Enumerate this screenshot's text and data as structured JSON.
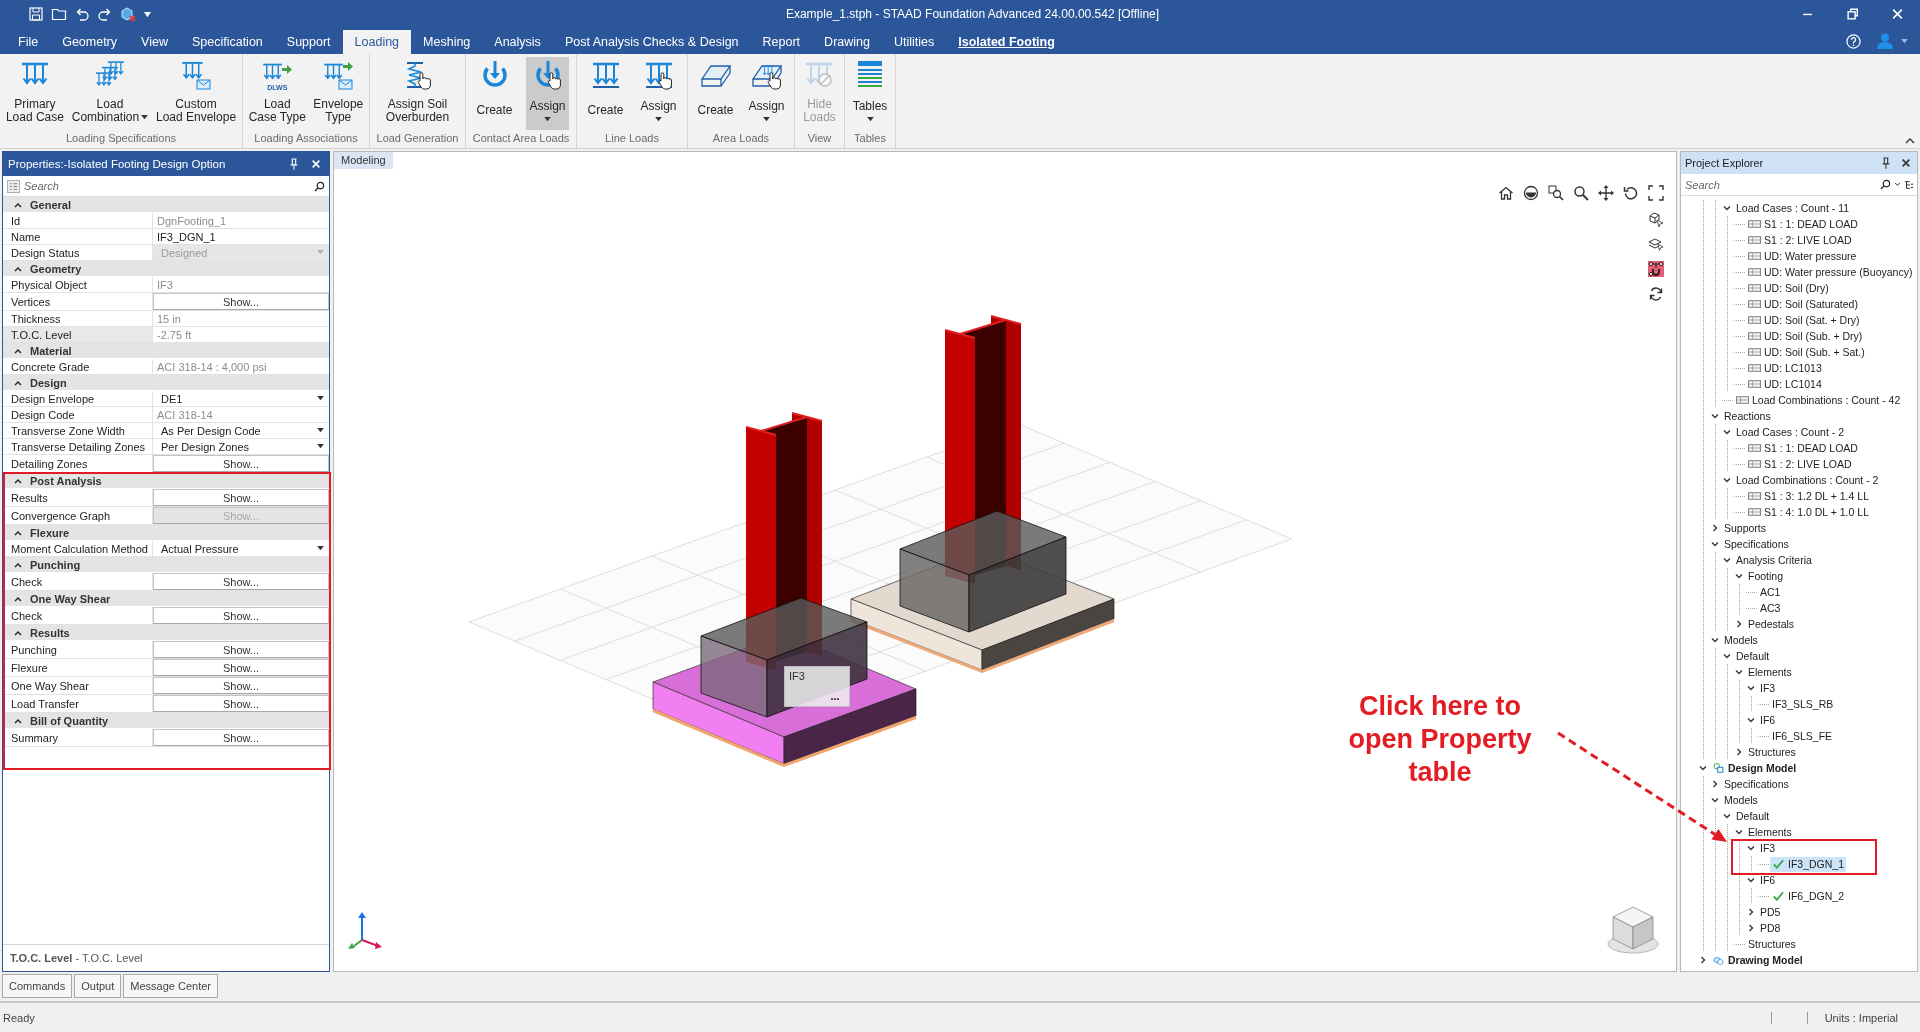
{
  "window": {
    "title": "Example_1.stph - STAAD Foundation Advanced 24.00.00.542 [Offline]"
  },
  "menu_tabs": [
    {
      "label": "File",
      "kind": "tab",
      "selected": false
    },
    {
      "label": "Geometry",
      "kind": "tab",
      "selected": false
    },
    {
      "label": "View",
      "kind": "tab",
      "selected": false
    },
    {
      "label": "Specification",
      "kind": "tab",
      "selected": false
    },
    {
      "label": "Support",
      "kind": "tab",
      "selected": false
    },
    {
      "label": "Loading",
      "kind": "tab",
      "selected": true
    },
    {
      "label": "Meshing",
      "kind": "tab",
      "selected": false
    },
    {
      "label": "Analysis",
      "kind": "tab",
      "selected": false
    },
    {
      "label": "Post Analysis Checks & Design",
      "kind": "tab",
      "selected": false
    },
    {
      "label": "Report",
      "kind": "tab",
      "selected": false
    },
    {
      "label": "Drawing",
      "kind": "tab",
      "selected": false
    },
    {
      "label": "Utilities",
      "kind": "tab",
      "selected": false
    },
    {
      "label": "Isolated Footing",
      "kind": "context",
      "selected": false
    }
  ],
  "ribbon": {
    "groups": [
      {
        "label": "Loading Specifications",
        "buttons": [
          {
            "kind": "primary-load",
            "lines": [
              "Primary",
              "Load Case"
            ],
            "dropdown": false,
            "pressed": false,
            "disabled": false
          },
          {
            "kind": "load-combination",
            "lines": [
              "Load",
              "Combination"
            ],
            "dropdown": true,
            "pressed": false,
            "disabled": false
          },
          {
            "kind": "custom-envelope",
            "lines": [
              "Custom",
              "Load Envelope"
            ],
            "dropdown": false,
            "pressed": false,
            "disabled": false
          }
        ]
      },
      {
        "label": "Loading Associations",
        "buttons": [
          {
            "kind": "load-case-type",
            "badge": "DLWS",
            "lines": [
              "Load",
              "Case Type"
            ],
            "dropdown": false,
            "pressed": false,
            "disabled": false
          },
          {
            "kind": "envelope-type",
            "lines": [
              "Envelope",
              "Type"
            ],
            "dropdown": false,
            "pressed": false,
            "disabled": false
          }
        ]
      },
      {
        "label": "Load Generation",
        "buttons": [
          {
            "kind": "soil-overburden",
            "lines": [
              "Assign Soil",
              "Overburden"
            ],
            "dropdown": false,
            "pressed": false,
            "disabled": false
          }
        ]
      },
      {
        "label": "Contact Area Loads",
        "buttons": [
          {
            "kind": "contact-create",
            "lines": [
              "Create"
            ],
            "dropdown": false,
            "pressed": false,
            "disabled": false
          },
          {
            "kind": "contact-assign",
            "lines": [
              "Assign"
            ],
            "dropdown": true,
            "pressed": true,
            "disabled": false
          }
        ]
      },
      {
        "label": "Line Loads",
        "buttons": [
          {
            "kind": "line-create",
            "lines": [
              "Create"
            ],
            "dropdown": false,
            "pressed": false,
            "disabled": false
          },
          {
            "kind": "line-assign",
            "lines": [
              "Assign"
            ],
            "dropdown": true,
            "pressed": false,
            "disabled": false
          }
        ]
      },
      {
        "label": "Area Loads",
        "buttons": [
          {
            "kind": "area-create",
            "lines": [
              "Create"
            ],
            "dropdown": false,
            "pressed": false,
            "disabled": false
          },
          {
            "kind": "area-assign",
            "lines": [
              "Assign"
            ],
            "dropdown": true,
            "pressed": false,
            "disabled": false
          }
        ]
      },
      {
        "label": "View",
        "buttons": [
          {
            "kind": "hide-loads",
            "lines": [
              "Hide",
              "Loads"
            ],
            "dropdown": false,
            "pressed": false,
            "disabled": true
          }
        ]
      },
      {
        "label": "Tables",
        "buttons": [
          {
            "kind": "tables",
            "lines": [
              "Tables"
            ],
            "dropdown": true,
            "pressed": false,
            "disabled": false
          }
        ]
      }
    ]
  },
  "properties": {
    "title": "Properties:-Isolated Footing Design Option",
    "search": {
      "placeholder": "Search"
    },
    "categories": [
      {
        "label": "General",
        "expanded": true,
        "rows": [
          {
            "name": "Id",
            "value": "DgnFooting_1",
            "kind": "text",
            "disabled": true,
            "selected": false
          },
          {
            "name": "Name",
            "value": "IF3_DGN_1",
            "kind": "text",
            "disabled": false,
            "selected": false
          },
          {
            "name": "Design Status",
            "value": "Designed",
            "kind": "dropdown",
            "disabled": true,
            "selected": false
          }
        ]
      },
      {
        "label": "Geometry",
        "expanded": true,
        "rows": [
          {
            "name": "Physical Object",
            "value": "IF3",
            "kind": "text",
            "disabled": true,
            "selected": false
          },
          {
            "name": "Vertices",
            "value": "Show...",
            "kind": "button",
            "disabled": false,
            "selected": false
          },
          {
            "name": "Thickness",
            "value": "15 in",
            "kind": "text",
            "disabled": true,
            "selected": false
          },
          {
            "name": "T.O.C. Level",
            "value": "-2.75 ft",
            "kind": "text",
            "disabled": true,
            "selected": true
          }
        ]
      },
      {
        "label": "Material",
        "expanded": true,
        "rows": [
          {
            "name": "Concrete Grade",
            "value": "ACI 318-14 : 4,000 psi",
            "kind": "text",
            "disabled": true,
            "selected": false
          }
        ]
      },
      {
        "label": "Design",
        "expanded": true,
        "rows": [
          {
            "name": "Design Envelope",
            "value": "DE1",
            "kind": "dropdown",
            "disabled": false,
            "selected": false
          },
          {
            "name": "Design Code",
            "value": "ACI 318-14",
            "kind": "text",
            "disabled": true,
            "selected": false
          },
          {
            "name": "Transverse Zone Width",
            "value": "As Per Design Code",
            "kind": "dropdown",
            "disabled": false,
            "selected": false
          },
          {
            "name": "Transverse Detailing Zones",
            "value": "Per Design Zones",
            "kind": "dropdown",
            "disabled": false,
            "selected": false
          },
          {
            "name": "Detailing Zones",
            "value": "Show...",
            "kind": "button",
            "disabled": false,
            "selected": false
          }
        ]
      },
      {
        "label": "Post Analysis",
        "expanded": true,
        "rows": [
          {
            "name": "Results",
            "value": "Show...",
            "kind": "button",
            "disabled": false,
            "selected": false
          },
          {
            "name": "Convergence Graph",
            "value": "Show...",
            "kind": "button",
            "disabled": true,
            "selected": false
          }
        ]
      },
      {
        "label": "Flexure",
        "expanded": true,
        "rows": [
          {
            "name": "Moment Calculation Method",
            "value": "Actual Pressure",
            "kind": "dropdown",
            "disabled": false,
            "selected": false
          }
        ]
      },
      {
        "label": "Punching",
        "expanded": true,
        "rows": [
          {
            "name": "Check",
            "value": "Show...",
            "kind": "button",
            "disabled": false,
            "selected": false
          }
        ]
      },
      {
        "label": "One Way Shear",
        "expanded": true,
        "rows": [
          {
            "name": "Check",
            "value": "Show...",
            "kind": "button",
            "disabled": false,
            "selected": false
          }
        ]
      },
      {
        "label": "Results",
        "expanded": true,
        "rows": [
          {
            "name": "Punching",
            "value": "Show...",
            "kind": "button",
            "disabled": false,
            "selected": false
          },
          {
            "name": "Flexure",
            "value": "Show...",
            "kind": "button",
            "disabled": false,
            "selected": false
          },
          {
            "name": "One Way Shear",
            "value": "Show...",
            "kind": "button",
            "disabled": false,
            "selected": false
          },
          {
            "name": "Load Transfer",
            "value": "Show...",
            "kind": "button",
            "disabled": false,
            "selected": false
          }
        ]
      },
      {
        "label": "Bill of Quantity",
        "expanded": true,
        "rows": [
          {
            "name": "Summary",
            "value": "Show...",
            "kind": "button",
            "disabled": false,
            "selected": false
          }
        ]
      }
    ],
    "description": "**T.O.C. Level** - T.O.C. Level"
  },
  "bottom_tabs": [
    "Commands",
    "Output",
    "Message Center"
  ],
  "viewport": {
    "tab": "Modeling",
    "footing_tag": {
      "text": "IF3",
      "more": "..."
    },
    "side_tools": [
      {
        "kind": "cube-select",
        "on": false
      },
      {
        "kind": "layer-select",
        "on": false
      },
      {
        "kind": "magnet",
        "on": true
      },
      {
        "kind": "refresh",
        "on": false
      }
    ]
  },
  "annotation": {
    "text": "Click here to open Property table"
  },
  "explorer": {
    "title": "Project Explorer",
    "search": {
      "placeholder": "Search"
    },
    "tree": [
      {
        "children": [
          {
            "children": [
              {
                "label": "Load Cases : Count - 11",
                "kind": "folder",
                "expanded": true,
                "selected": false,
                "children": [
                  {
                    "label": "S1 : 1: DEAD LOAD",
                    "kind": "load",
                    "selected": false
                  },
                  {
                    "label": "S1 : 2: LIVE LOAD",
                    "kind": "load",
                    "selected": false
                  },
                  {
                    "label": "UD: Water pressure",
                    "kind": "load",
                    "selected": false
                  },
                  {
                    "label": "UD: Water pressure (Buoyancy)",
                    "kind": "load",
                    "selected": false
                  },
                  {
                    "label": "UD: Soil (Dry)",
                    "kind": "load",
                    "selected": false
                  },
                  {
                    "label": "UD: Soil (Saturated)",
                    "kind": "load",
                    "selected": false
                  },
                  {
                    "label": "UD: Soil (Sat. + Dry)",
                    "kind": "load",
                    "selected": false
                  },
                  {
                    "label": "UD: Soil (Sub. + Dry)",
                    "kind": "load",
                    "selected": false
                  },
                  {
                    "label": "UD: Soil (Sub. + Sat.)",
                    "kind": "load",
                    "selected": false
                  },
                  {
                    "label": "UD: LC1013",
                    "kind": "load",
                    "selected": false
                  },
                  {
                    "label": "UD: LC1014",
                    "kind": "load",
                    "selected": false
                  }
                ]
              },
              {
                "label": "Load Combinations : Count - 42",
                "kind": "load",
                "selected": false
              }
            ]
          },
          {
            "label": "Reactions",
            "kind": "folder",
            "expanded": true,
            "selected": false,
            "children": [
              {
                "label": "Load Cases : Count - 2",
                "kind": "folder",
                "expanded": true,
                "selected": false,
                "children": [
                  {
                    "label": "S1 : 1: DEAD LOAD",
                    "kind": "load",
                    "selected": false
                  },
                  {
                    "label": "S1 : 2: LIVE LOAD",
                    "kind": "load",
                    "selected": false
                  }
                ]
              },
              {
                "label": "Load Combinations : Count - 2",
                "kind": "folder",
                "expanded": true,
                "selected": false,
                "children": [
                  {
                    "label": "S1 : 3: 1.2 DL + 1.4 LL",
                    "kind": "load",
                    "selected": false
                  },
                  {
                    "label": "S1 : 4: 1.0 DL + 1.0 LL",
                    "kind": "load",
                    "selected": false
                  }
                ]
              }
            ]
          },
          {
            "label": "Supports",
            "kind": "folder",
            "expanded": false,
            "selected": false
          },
          {
            "label": "Specifications",
            "kind": "folder",
            "expanded": true,
            "selected": false,
            "children": [
              {
                "label": "Analysis Criteria",
                "kind": "folder",
                "expanded": true,
                "selected": false,
                "children": [
                  {
                    "label": "Footing",
                    "kind": "folder",
                    "expanded": true,
                    "selected": false,
                    "children": [
                      {
                        "label": "AC1",
                        "kind": "leaf",
                        "selected": false
                      },
                      {
                        "label": "AC3",
                        "kind": "leaf",
                        "selected": false
                      }
                    ]
                  },
                  {
                    "label": "Pedestals",
                    "kind": "folder",
                    "expanded": false,
                    "selected": false
                  }
                ]
              }
            ]
          },
          {
            "label": "Models",
            "kind": "folder",
            "expanded": true,
            "selected": false,
            "children": [
              {
                "label": "Default",
                "kind": "folder",
                "expanded": true,
                "selected": false,
                "children": [
                  {
                    "label": "Elements",
                    "kind": "folder",
                    "expanded": true,
                    "selected": false,
                    "children": [
                      {
                        "label": "IF3",
                        "kind": "folder",
                        "expanded": true,
                        "selected": false,
                        "children": [
                          {
                            "label": "IF3_SLS_RB",
                            "kind": "leaf",
                            "selected": false
                          }
                        ]
                      },
                      {
                        "label": "IF6",
                        "kind": "folder",
                        "expanded": true,
                        "selected": false,
                        "children": [
                          {
                            "label": "IF6_SLS_FE",
                            "kind": "leaf",
                            "selected": false
                          }
                        ]
                      }
                    ]
                  },
                  {
                    "label": "Structures",
                    "kind": "folder",
                    "expanded": false,
                    "selected": false
                  }
                ]
              }
            ]
          }
        ]
      },
      {
        "label": "Design Model",
        "kind": "design-model",
        "expanded": true,
        "selected": false,
        "children": [
          {
            "label": "Specifications",
            "kind": "folder",
            "expanded": false,
            "selected": false
          },
          {
            "label": "Models",
            "kind": "folder",
            "expanded": true,
            "selected": false,
            "children": [
              {
                "label": "Default",
                "kind": "folder",
                "expanded": true,
                "selected": false,
                "children": [
                  {
                    "label": "Elements",
                    "kind": "folder",
                    "expanded": true,
                    "selected": false,
                    "children": [
                      {
                        "label": "IF3",
                        "kind": "folder",
                        "expanded": true,
                        "selected": false,
                        "children": [
                          {
                            "label": "IF3_DGN_1",
                            "kind": "result",
                            "selected": true
                          }
                        ]
                      },
                      {
                        "label": "IF6",
                        "kind": "folder",
                        "expanded": true,
                        "selected": false,
                        "children": [
                          {
                            "label": "IF6_DGN_2",
                            "kind": "result",
                            "selected": false
                          }
                        ]
                      },
                      {
                        "label": "PD5",
                        "kind": "folder",
                        "expanded": false,
                        "selected": false
                      },
                      {
                        "label": "PD8",
                        "kind": "folder",
                        "expanded": false,
                        "selected": false
                      }
                    ]
                  },
                  {
                    "label": "Structures",
                    "kind": "leaf",
                    "selected": false
                  }
                ]
              }
            ]
          }
        ]
      },
      {
        "label": "Drawing Model",
        "kind": "drawing-model",
        "expanded": false,
        "selected": false
      }
    ]
  },
  "status_bar": {
    "message": "Ready",
    "units": "Units : Imperial"
  }
}
